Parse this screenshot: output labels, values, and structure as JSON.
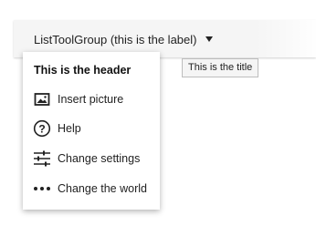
{
  "toolbar": {
    "group_button_label": "ListToolGroup (this is the label)",
    "caret_icon": "caret-down-icon"
  },
  "tooltip": {
    "text": "This is the title"
  },
  "menu": {
    "header": "This is the header",
    "items": [
      {
        "label": "Insert picture",
        "icon": "picture-icon"
      },
      {
        "label": "Help",
        "icon": "help-circle-icon"
      },
      {
        "label": "Change settings",
        "icon": "sliders-icon"
      },
      {
        "label": "Change the world",
        "icon": "more-dots-icon"
      }
    ]
  }
}
